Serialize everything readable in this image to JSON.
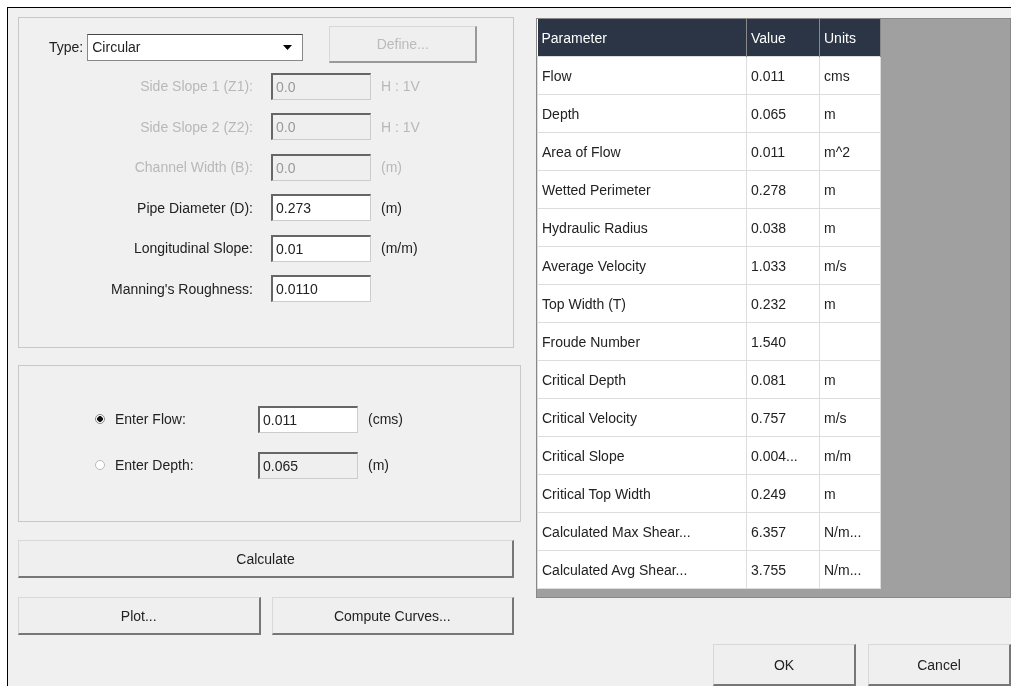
{
  "type_field": {
    "label": "Type:",
    "value": "Circular"
  },
  "define_button": {
    "label": "Define...",
    "disabled": true
  },
  "fields": [
    {
      "label": "Side Slope 1 (Z1):",
      "value": "0.0",
      "unit": "H : 1V",
      "disabled": true
    },
    {
      "label": "Side Slope 2 (Z2):",
      "value": "0.0",
      "unit": "H : 1V",
      "disabled": true
    },
    {
      "label": "Channel Width (B):",
      "value": "0.0",
      "unit": "(m)",
      "disabled": true
    },
    {
      "label": "Pipe Diameter (D):",
      "value": "0.273",
      "unit": "(m)",
      "disabled": false
    },
    {
      "label": "Longitudinal Slope:",
      "value": "0.01",
      "unit": "(m/m)",
      "disabled": false
    },
    {
      "label": "Manning's Roughness:",
      "value": "0.0110",
      "disabled": false
    }
  ],
  "modes": [
    {
      "label": "Enter Flow:",
      "value": "0.011",
      "unit": "(cms)",
      "selected": true
    },
    {
      "label": "Enter Depth:",
      "value": "0.065",
      "unit": "(m)",
      "selected": false
    }
  ],
  "calculate_button": "Calculate",
  "plot_button": "Plot...",
  "curves_button": "Compute Curves...",
  "table": {
    "columns": [
      "Parameter",
      "Value",
      "Units"
    ],
    "rows": [
      [
        "Flow",
        "0.011",
        "cms"
      ],
      [
        "Depth",
        "0.065",
        "m"
      ],
      [
        "Area of Flow",
        "0.011",
        "m^2"
      ],
      [
        "Wetted Perimeter",
        "0.278",
        "m"
      ],
      [
        "Hydraulic Radius",
        "0.038",
        "m"
      ],
      [
        "Average Velocity",
        "1.033",
        "m/s"
      ],
      [
        "Top Width (T)",
        "0.232",
        "m"
      ],
      [
        "Froude Number",
        "1.540",
        ""
      ],
      [
        "Critical Depth",
        "0.081",
        "m"
      ],
      [
        "Critical Velocity",
        "0.757",
        "m/s"
      ],
      [
        "Critical Slope",
        "0.004...",
        "m/m"
      ],
      [
        "Critical Top Width",
        "0.249",
        "m"
      ],
      [
        "Calculated Max Shear...",
        "6.357",
        "N/m..."
      ],
      [
        "Calculated Avg Shear...",
        "3.755",
        "N/m..."
      ]
    ]
  },
  "buttons": [
    "OK",
    "Cancel"
  ]
}
